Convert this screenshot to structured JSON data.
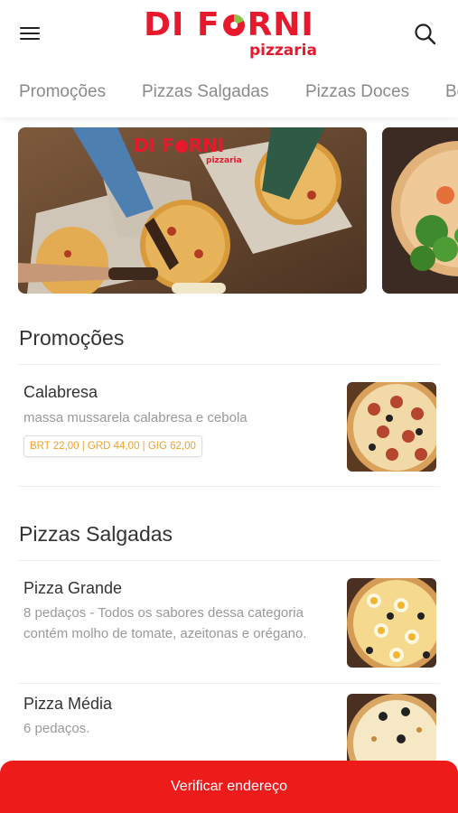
{
  "header": {
    "logo_main_left": "DI F",
    "logo_main_right": "RNI",
    "logo_sub": "pizzaria",
    "menu_icon": "hamburger-menu-icon",
    "search_icon": "search-icon",
    "brand_color": "#e8192c"
  },
  "tabs": [
    "Promoções",
    "Pizzas Salgadas",
    "Pizzas Doces",
    "Be"
  ],
  "banner": {
    "logo_left": "DI F",
    "logo_right": "RNI",
    "logo_sub": "pizzaria"
  },
  "sections": [
    {
      "title": "Promoções",
      "items": [
        {
          "name": "Calabresa",
          "description": "massa mussarela calabresa e cebola",
          "price": "BRT 22,00 | GRD 44,00 | GIG 62,00"
        }
      ]
    },
    {
      "title": "Pizzas Salgadas",
      "items": [
        {
          "name": "Pizza Grande",
          "description": "8 pedaços - Todos os sabores dessa categoria contém molho de tomate, azeitonas e orégano."
        },
        {
          "name": "Pizza Média",
          "description": "6 pedaços."
        }
      ]
    }
  ],
  "cta": {
    "label": "Verificar endereço",
    "color": "#ee1b1b"
  },
  "price_color": "#f0a22a"
}
